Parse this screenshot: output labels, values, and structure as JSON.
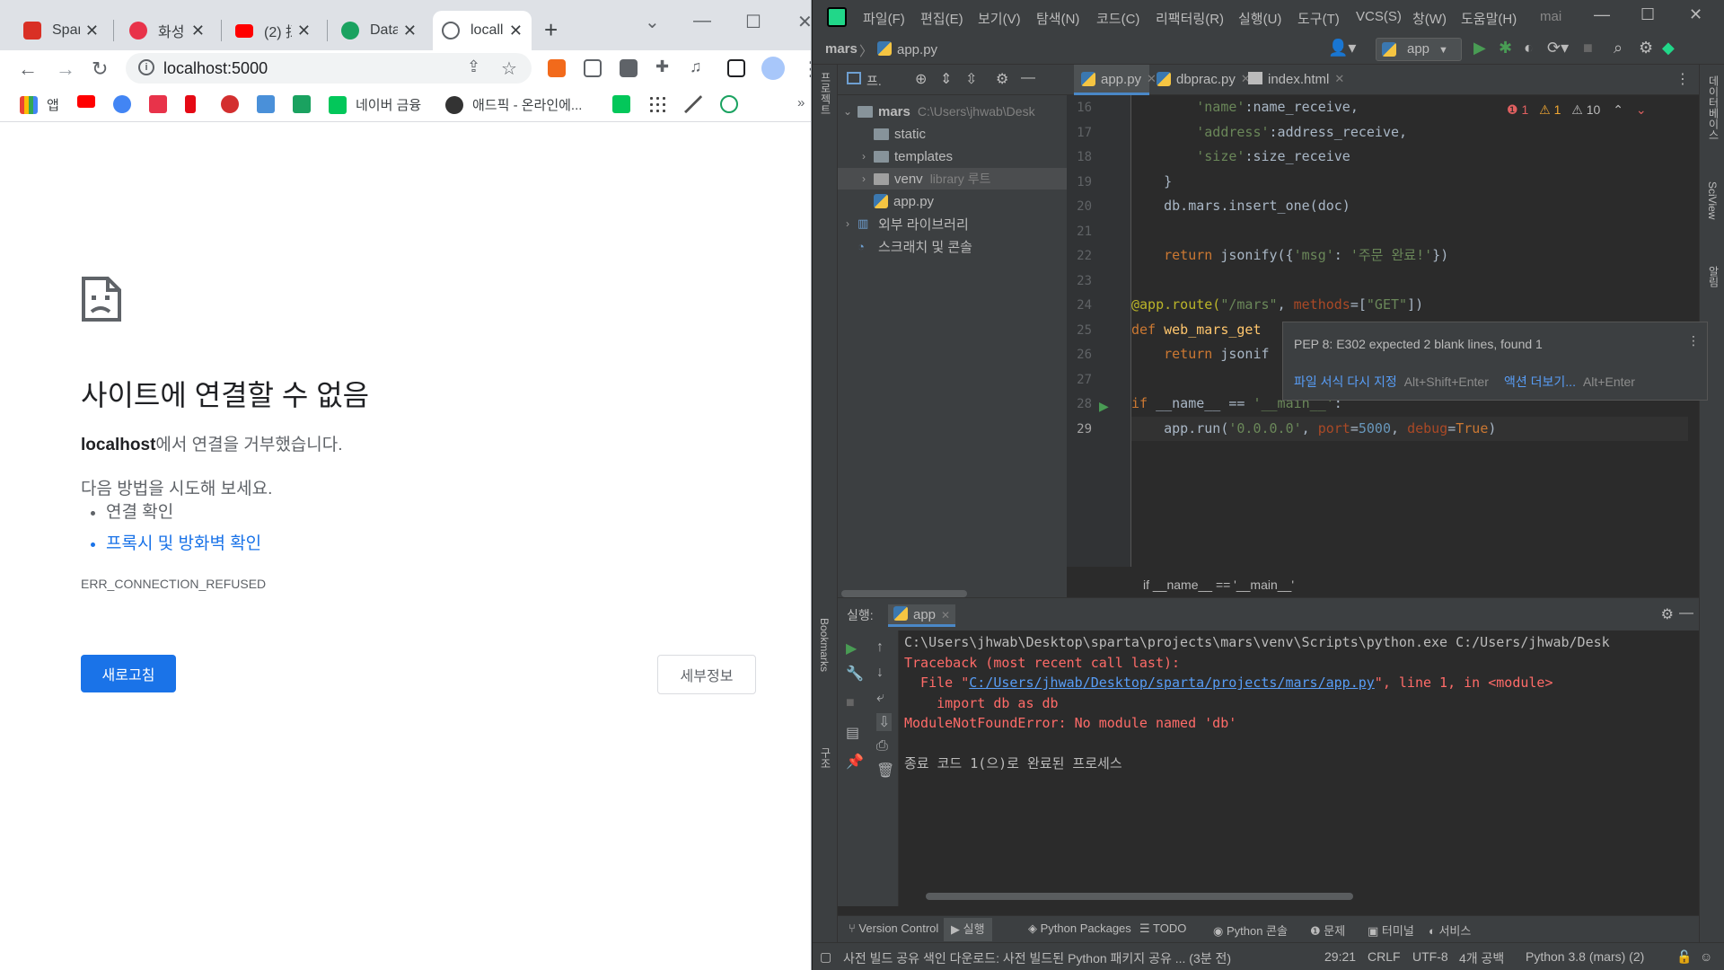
{
  "chrome": {
    "tabs": [
      {
        "title": "Spart",
        "fav": "#d93025"
      },
      {
        "title": "화성",
        "fav": "#e8334a"
      },
      {
        "title": "(2) 㧎",
        "fav": "#ff0000"
      },
      {
        "title": "Data",
        "fav": "#1aa260"
      },
      {
        "title": "locall",
        "fav": "#5f6368"
      }
    ],
    "address": "localhost:5000",
    "bookmarks": [
      {
        "label": "앱",
        "color": "#4285f4"
      },
      {
        "label": "",
        "color": "#ff0000"
      },
      {
        "label": "",
        "color": "#4285f4"
      },
      {
        "label": "",
        "color": "#e8334a"
      },
      {
        "label": "",
        "color": "#e50914"
      },
      {
        "label": "",
        "color": "#d32f2f"
      },
      {
        "label": "",
        "color": "#4a90d9"
      },
      {
        "label": "",
        "color": "#1aa260"
      },
      {
        "label": "네이버 금융",
        "color": "#03c75a"
      },
      {
        "label": "애드픽 - 온라인에...",
        "color": "#333333"
      },
      {
        "label": "",
        "color": "#03c75a"
      },
      {
        "label": "",
        "color": "#444444"
      },
      {
        "label": "",
        "color": "#555555"
      },
      {
        "label": "",
        "color": "#1aa260"
      }
    ],
    "error": {
      "title": "사이트에 연결할 수 없음",
      "host": "localhost",
      "host_suffix": "에서 연결을 거부했습니다.",
      "try_label": "다음 방법을 시도해 보세요.",
      "suggestions": [
        "연결 확인",
        "프록시 및 방화벽 확인"
      ],
      "code": "ERR_CONNECTION_REFUSED",
      "reload": "새로고침",
      "details": "세부정보"
    }
  },
  "pycharm": {
    "menu": [
      "파일(F)",
      "편집(E)",
      "보기(V)",
      "탐색(N)",
      "코드(C)",
      "리팩터링(R)",
      "실행(U)",
      "도구(T)",
      "VCS(S)",
      "창(W)",
      "도움말(H)",
      "mai"
    ],
    "breadcrumb": {
      "project": "mars",
      "file": "app.py"
    },
    "run_config": "app",
    "project_panel": {
      "label": "프.",
      "side_label": "프로젝트"
    },
    "tree": [
      {
        "label": "mars",
        "hint": "C:\\Users\\jhwab\\Desk",
        "type": "folder",
        "depth": 0,
        "arrow": "v"
      },
      {
        "label": "static",
        "hint": "",
        "type": "folder",
        "depth": 1,
        "arrow": ""
      },
      {
        "label": "templates",
        "hint": "",
        "type": "folder",
        "depth": 1,
        "arrow": ">"
      },
      {
        "label": "venv",
        "hint": "library 루트",
        "type": "folder",
        "depth": 1,
        "arrow": ">"
      },
      {
        "label": "app.py",
        "hint": "",
        "type": "py",
        "depth": 1,
        "arrow": ""
      },
      {
        "label": "외부 라이브러리",
        "hint": "",
        "type": "lib",
        "depth": 0,
        "arrow": ">"
      },
      {
        "label": "스크래치 및 콘솔",
        "hint": "",
        "type": "scratch",
        "depth": 0,
        "arrow": ""
      }
    ],
    "editor_tabs": [
      "app.py",
      "dbprac.py",
      "index.html"
    ],
    "inspections": {
      "errors": "1",
      "warnings": "1",
      "weak": "10"
    },
    "line_numbers": [
      "16",
      "17",
      "18",
      "19",
      "20",
      "21",
      "22",
      "23",
      "24",
      "25",
      "26",
      "27",
      "28",
      "29"
    ],
    "popup": {
      "message": "PEP 8: E302 expected 2 blank lines, found 1",
      "action1": "파일 서식 다시 지정",
      "shortcut1": "Alt+Shift+Enter",
      "action2": "액션 더보기...",
      "shortcut2": "Alt+Enter"
    },
    "editor_breadcrumb": "if __name__ == '__main__'",
    "run": {
      "label": "실행:",
      "tab": "app",
      "lines": [
        "C:\\Users\\jhwab\\Desktop\\sparta\\projects\\mars\\venv\\Scripts\\python.exe C:/Users/jhwab/Desk",
        "Traceback (most recent call last):",
        "  File \"",
        "    import db as db",
        "ModuleNotFoundError: No module named 'db'",
        "",
        "종료 코드 1(으)로 완료된 프로세스"
      ],
      "file_link": "C:/Users/jhwab/Desktop/sparta/projects/mars/app.py",
      "file_suffix": "\", line 1, in <module>"
    },
    "tool_windows": [
      "Version Control",
      "실행",
      "Python Packages",
      "TODO",
      "Python 콘솔",
      "문제",
      "터미널",
      "서비스"
    ],
    "side_labels": {
      "bookmarks": "Bookmarks",
      "structure": "구조",
      "database": "데이터베이스",
      "sciview": "SciView",
      "notifications": "알림"
    },
    "status": {
      "message": "사전 빌드 공유 색인 다운로드: 사전 빌드된 Python 패키지 공유 ... (3분 전)",
      "position": "29:21",
      "line_sep": "CRLF",
      "encoding": "UTF-8",
      "indent": "4개 공백",
      "interpreter": "Python 3.8 (mars) (2)"
    }
  }
}
